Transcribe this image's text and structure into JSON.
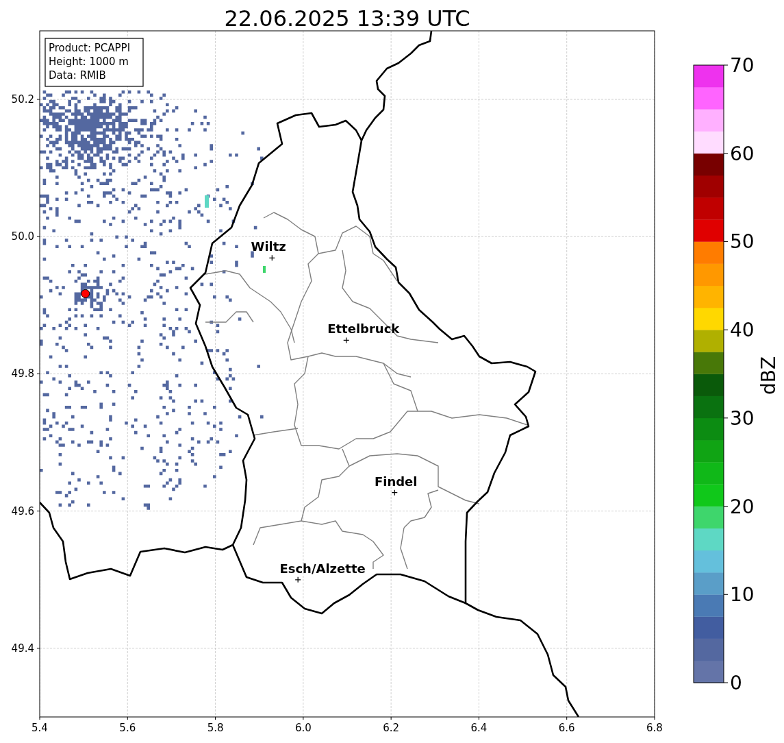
{
  "title": "22.06.2025 13:39 UTC",
  "info_box": [
    "Product: PCAPPI",
    "Height: 1000 m",
    "Data: RMIB"
  ],
  "xticks": [
    "5.4",
    "5.6",
    "5.8",
    "6.0",
    "6.2",
    "6.4",
    "6.6",
    "6.8"
  ],
  "yticks": [
    "50.2",
    "50.0",
    "49.8",
    "49.6",
    "49.4"
  ],
  "places": [
    {
      "name": "Wiltz"
    },
    {
      "name": "Ettelbruck"
    },
    {
      "name": "Findel"
    },
    {
      "name": "Esch/Alzette"
    }
  ],
  "colorbar": {
    "label": "dBZ",
    "ticks": [
      "70",
      "60",
      "50",
      "40",
      "30",
      "20",
      "10",
      "0"
    ],
    "bins": [
      {
        "color": "#6474a8"
      },
      {
        "color": "#5468a0"
      },
      {
        "color": "#425da0"
      },
      {
        "color": "#4a7ab4"
      },
      {
        "color": "#5a9ec8"
      },
      {
        "color": "#64c0dc"
      },
      {
        "color": "#5ed8c4"
      },
      {
        "color": "#3ed66c"
      },
      {
        "color": "#10c81a"
      },
      {
        "color": "#10b818"
      },
      {
        "color": "#10a414"
      },
      {
        "color": "#0c8c12"
      },
      {
        "color": "#0a7210"
      },
      {
        "color": "#0a5a0a"
      },
      {
        "color": "#487808"
      },
      {
        "color": "#b0b000"
      },
      {
        "color": "#ffd800"
      },
      {
        "color": "#ffb400"
      },
      {
        "color": "#ff9800"
      },
      {
        "color": "#ff7c00"
      },
      {
        "color": "#e00000"
      },
      {
        "color": "#c00000"
      },
      {
        "color": "#a00000"
      },
      {
        "color": "#780000"
      },
      {
        "color": "#ffdcff"
      },
      {
        "color": "#ffb0ff"
      },
      {
        "color": "#ff64ff"
      },
      {
        "color": "#ee32ee"
      }
    ]
  }
}
